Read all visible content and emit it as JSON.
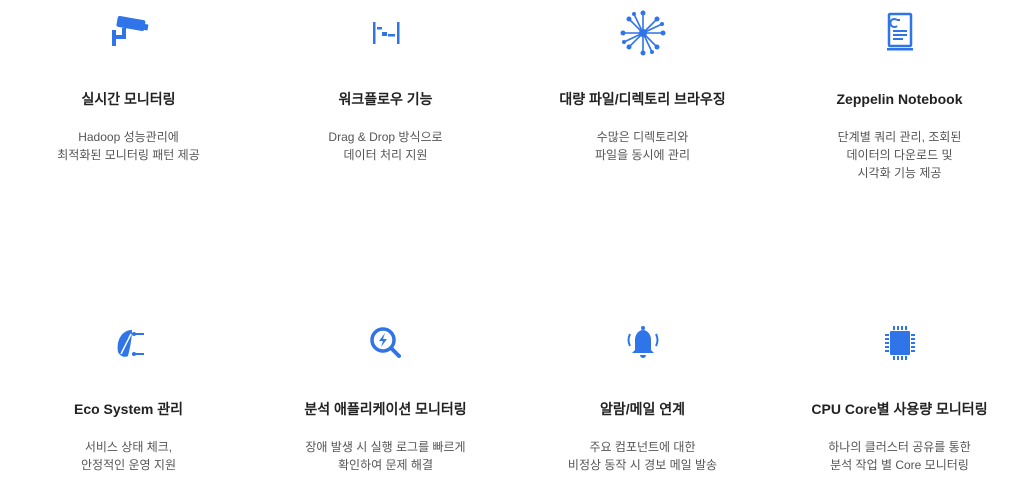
{
  "colors": {
    "accent": "#2f74e8",
    "title": "#222222",
    "text": "#555555",
    "background": "#ffffff"
  },
  "features": [
    {
      "icon": "cctv-camera-icon",
      "title": "실시간 모니터링",
      "desc": [
        "Hadoop 성능관리에",
        "최적화된 모니터링 패턴 제공"
      ]
    },
    {
      "icon": "workflow-icon",
      "title": "워크플로우 기능",
      "desc": [
        "Drag & Drop 방식으로",
        "데이터 처리 지원"
      ]
    },
    {
      "icon": "network-node-icon",
      "title": "대량 파일/디렉토리 브라우징",
      "desc": [
        "수많은 디렉토리와",
        "파일을 동시에 관리"
      ]
    },
    {
      "icon": "notebook-icon",
      "title": "Zeppelin Notebook",
      "desc": [
        "단계별 쿼리 관리, 조회된",
        "데이터의 다운로드 및",
        "시각화 기능 제공"
      ]
    },
    {
      "icon": "ecosystem-leaf-icon",
      "title": "Eco System 관리",
      "desc": [
        "서비스 상태 체크,",
        "안정적인 운영 지원"
      ]
    },
    {
      "icon": "search-bolt-icon",
      "title": "분석 애플리케이션 모니터링",
      "desc": [
        "장애 발생 시 실행 로그를 빠르게",
        "확인하여 문제 해결"
      ]
    },
    {
      "icon": "bell-alarm-icon",
      "title": "알람/메일 연계",
      "desc": [
        "주요 컴포넌트에 대한",
        "비정상 동작 시 경보 메일 발송"
      ]
    },
    {
      "icon": "cpu-chip-icon",
      "title": "CPU Core별 사용량 모니터링",
      "desc": [
        "하나의 클러스터 공유를 통한",
        "분석 작업 별 Core 모니터링"
      ]
    }
  ]
}
